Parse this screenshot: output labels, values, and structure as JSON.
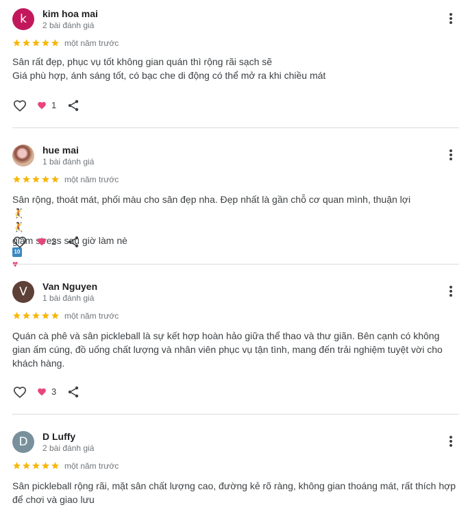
{
  "colors": {
    "star": "#f7b70b",
    "heart": "#e8457c",
    "divider": "#dadce0"
  },
  "reviews": [
    {
      "initial": "k",
      "avatar_color": "#c2185b",
      "name": "kim hoa mai",
      "review_count": "2 bài đánh giá",
      "rating": 5,
      "time": "một năm trước",
      "lines": [
        "Sân rất đẹp, phục vụ tốt không gian quán thì rộng rãi sạch sẽ",
        "Giá phù hợp, ánh sáng tốt, có bạc che di động có thể mở ra khi chiều mát"
      ],
      "likes": "1"
    },
    {
      "initial": "",
      "avatar_color": "",
      "name": "hue mai",
      "review_count": "1 bài đánh giá",
      "rating": 5,
      "time": "một năm trước",
      "lines": [
        "Sân rộng, thoát mát, phối màu cho sân đẹp nha. Đẹp nhất là gần chỗ cơ quan mình, thuận lợi",
        "giảm stress sau giờ làm nè"
      ],
      "emoji_10": "10",
      "likes": "2"
    },
    {
      "initial": "V",
      "avatar_color": "#5d4037",
      "name": "Van Nguyen",
      "review_count": "1 bài đánh giá",
      "rating": 5,
      "time": "một năm trước",
      "lines": [
        "Quán cà phê và sân pickleball là sự kết hợp hoàn hảo giữa thể thao và thư giãn. Bên cạnh có không",
        "gian ấm cúng, đồ uống chất lượng và nhân viên phục vụ tận tình, mang đến trải nghiệm tuyệt vời cho",
        "khách hàng."
      ],
      "likes": "3"
    },
    {
      "initial": "D",
      "avatar_color": "#78909c",
      "name": "D Luffy",
      "review_count": "2 bài đánh giá",
      "rating": 5,
      "time": "một năm trước",
      "lines": [
        "Sân pickleball rộng rãi, mặt sân chất lượng cao, đường kẻ rõ ràng, không gian thoáng mát, rất thích hợp",
        "để chơi và giao lưu"
      ]
    }
  ]
}
